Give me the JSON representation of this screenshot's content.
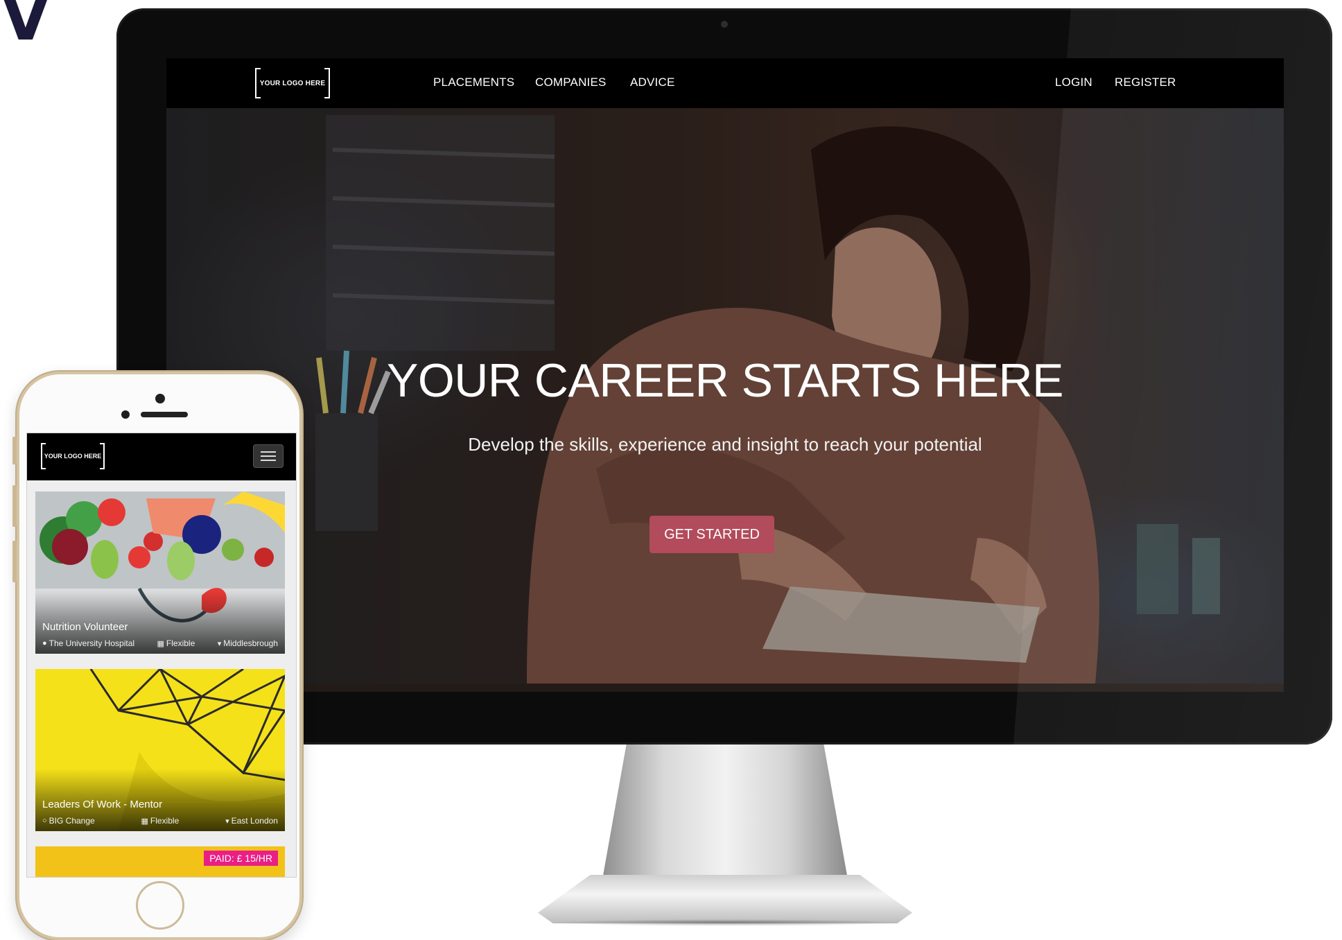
{
  "corner_glyph": "V",
  "desktop": {
    "logo_text": "YOUR LOGO HERE",
    "nav": {
      "placements": "PLACEMENTS",
      "companies": "COMPANIES",
      "advice": "ADVICE",
      "login": "LOGIN",
      "register": "REGISTER"
    },
    "hero": {
      "title": "YOUR CAREER STARTS HERE",
      "subtitle": "Develop the skills, experience and insight to reach your potential",
      "cta": "GET STARTED"
    }
  },
  "mobile": {
    "logo_text": "YOUR LOGO HERE",
    "menu_icon": "hamburger-menu-icon",
    "cards": [
      {
        "title": "Nutrition Volunteer",
        "company": "The University Hospital",
        "schedule": "Flexible",
        "location": "Middlesbrough"
      },
      {
        "title": "Leaders Of Work - Mentor",
        "company": "BIG Change",
        "schedule": "Flexible",
        "location": "East London"
      }
    ],
    "partial_card_badge": "PAID: £ 15/HR"
  },
  "colors": {
    "cta": "#b24b5b",
    "paid_badge": "#ea1f86",
    "nav_bg": "#000000",
    "card2_bg": "#f5e119"
  }
}
